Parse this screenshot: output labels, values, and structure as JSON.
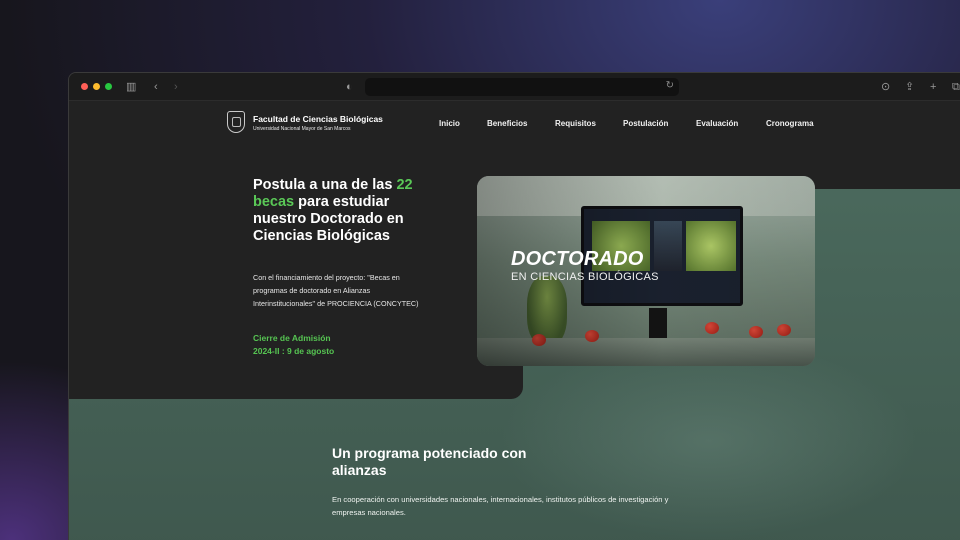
{
  "browser": {
    "url": "",
    "icons": [
      "sidebar-icon",
      "back-icon",
      "forward-icon",
      "shield-icon",
      "reload-icon",
      "download-icon",
      "share-icon",
      "new-tab-icon",
      "tabs-icon"
    ]
  },
  "brand": {
    "title": "Facultad de Ciencias Biológicas",
    "subtitle": "Universidad Nacional Mayor de San Marcos"
  },
  "nav": {
    "items": [
      "Inicio",
      "Beneficios",
      "Requisitos",
      "Postulación",
      "Evaluación",
      "Cronograma"
    ]
  },
  "hero": {
    "headline_pre": "Postula a una de las ",
    "headline_accent": "22 becas",
    "headline_post": " para estudiar nuestro Doctorado en Ciencias Biológicas",
    "description": "Con el financiamiento del proyecto: \"Becas en programas de doctorado en Alianzas Interinstitucionales\" de PROCIENCIA (CONCYTEC)",
    "deadline_line1": "Cierre de Admisión",
    "deadline_line2": "2024-II : 9 de agosto",
    "image_title": "DOCTORADO",
    "image_subtitle": "EN CIENCIAS BIOLÓGICAS"
  },
  "section": {
    "title": "Un programa potenciado con alianzas",
    "description": "En cooperación con universidades nacionales, internacionales, institutos públicos de investigación y empresas nacionales."
  },
  "colors": {
    "accent_green": "#5ac857",
    "panel_dark": "#222222",
    "section_green": "#4d6d60"
  }
}
